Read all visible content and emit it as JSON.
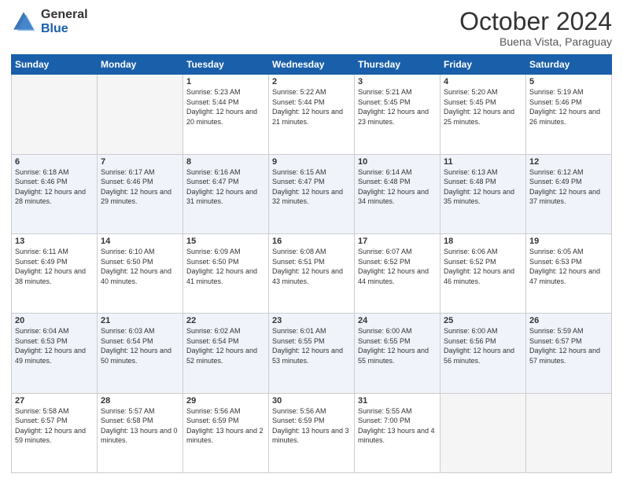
{
  "header": {
    "logo_general": "General",
    "logo_blue": "Blue",
    "month_title": "October 2024",
    "location": "Buena Vista, Paraguay"
  },
  "calendar": {
    "days_of_week": [
      "Sunday",
      "Monday",
      "Tuesday",
      "Wednesday",
      "Thursday",
      "Friday",
      "Saturday"
    ],
    "weeks": [
      [
        {
          "day": "",
          "empty": true
        },
        {
          "day": "",
          "empty": true
        },
        {
          "day": "1",
          "sunrise": "Sunrise: 5:23 AM",
          "sunset": "Sunset: 5:44 PM",
          "daylight": "Daylight: 12 hours and 20 minutes."
        },
        {
          "day": "2",
          "sunrise": "Sunrise: 5:22 AM",
          "sunset": "Sunset: 5:44 PM",
          "daylight": "Daylight: 12 hours and 21 minutes."
        },
        {
          "day": "3",
          "sunrise": "Sunrise: 5:21 AM",
          "sunset": "Sunset: 5:45 PM",
          "daylight": "Daylight: 12 hours and 23 minutes."
        },
        {
          "day": "4",
          "sunrise": "Sunrise: 5:20 AM",
          "sunset": "Sunset: 5:45 PM",
          "daylight": "Daylight: 12 hours and 25 minutes."
        },
        {
          "day": "5",
          "sunrise": "Sunrise: 5:19 AM",
          "sunset": "Sunset: 5:46 PM",
          "daylight": "Daylight: 12 hours and 26 minutes."
        }
      ],
      [
        {
          "day": "6",
          "sunrise": "Sunrise: 6:18 AM",
          "sunset": "Sunset: 6:46 PM",
          "daylight": "Daylight: 12 hours and 28 minutes."
        },
        {
          "day": "7",
          "sunrise": "Sunrise: 6:17 AM",
          "sunset": "Sunset: 6:46 PM",
          "daylight": "Daylight: 12 hours and 29 minutes."
        },
        {
          "day": "8",
          "sunrise": "Sunrise: 6:16 AM",
          "sunset": "Sunset: 6:47 PM",
          "daylight": "Daylight: 12 hours and 31 minutes."
        },
        {
          "day": "9",
          "sunrise": "Sunrise: 6:15 AM",
          "sunset": "Sunset: 6:47 PM",
          "daylight": "Daylight: 12 hours and 32 minutes."
        },
        {
          "day": "10",
          "sunrise": "Sunrise: 6:14 AM",
          "sunset": "Sunset: 6:48 PM",
          "daylight": "Daylight: 12 hours and 34 minutes."
        },
        {
          "day": "11",
          "sunrise": "Sunrise: 6:13 AM",
          "sunset": "Sunset: 6:48 PM",
          "daylight": "Daylight: 12 hours and 35 minutes."
        },
        {
          "day": "12",
          "sunrise": "Sunrise: 6:12 AM",
          "sunset": "Sunset: 6:49 PM",
          "daylight": "Daylight: 12 hours and 37 minutes."
        }
      ],
      [
        {
          "day": "13",
          "sunrise": "Sunrise: 6:11 AM",
          "sunset": "Sunset: 6:49 PM",
          "daylight": "Daylight: 12 hours and 38 minutes."
        },
        {
          "day": "14",
          "sunrise": "Sunrise: 6:10 AM",
          "sunset": "Sunset: 6:50 PM",
          "daylight": "Daylight: 12 hours and 40 minutes."
        },
        {
          "day": "15",
          "sunrise": "Sunrise: 6:09 AM",
          "sunset": "Sunset: 6:50 PM",
          "daylight": "Daylight: 12 hours and 41 minutes."
        },
        {
          "day": "16",
          "sunrise": "Sunrise: 6:08 AM",
          "sunset": "Sunset: 6:51 PM",
          "daylight": "Daylight: 12 hours and 43 minutes."
        },
        {
          "day": "17",
          "sunrise": "Sunrise: 6:07 AM",
          "sunset": "Sunset: 6:52 PM",
          "daylight": "Daylight: 12 hours and 44 minutes."
        },
        {
          "day": "18",
          "sunrise": "Sunrise: 6:06 AM",
          "sunset": "Sunset: 6:52 PM",
          "daylight": "Daylight: 12 hours and 46 minutes."
        },
        {
          "day": "19",
          "sunrise": "Sunrise: 6:05 AM",
          "sunset": "Sunset: 6:53 PM",
          "daylight": "Daylight: 12 hours and 47 minutes."
        }
      ],
      [
        {
          "day": "20",
          "sunrise": "Sunrise: 6:04 AM",
          "sunset": "Sunset: 6:53 PM",
          "daylight": "Daylight: 12 hours and 49 minutes."
        },
        {
          "day": "21",
          "sunrise": "Sunrise: 6:03 AM",
          "sunset": "Sunset: 6:54 PM",
          "daylight": "Daylight: 12 hours and 50 minutes."
        },
        {
          "day": "22",
          "sunrise": "Sunrise: 6:02 AM",
          "sunset": "Sunset: 6:54 PM",
          "daylight": "Daylight: 12 hours and 52 minutes."
        },
        {
          "day": "23",
          "sunrise": "Sunrise: 6:01 AM",
          "sunset": "Sunset: 6:55 PM",
          "daylight": "Daylight: 12 hours and 53 minutes."
        },
        {
          "day": "24",
          "sunrise": "Sunrise: 6:00 AM",
          "sunset": "Sunset: 6:55 PM",
          "daylight": "Daylight: 12 hours and 55 minutes."
        },
        {
          "day": "25",
          "sunrise": "Sunrise: 6:00 AM",
          "sunset": "Sunset: 6:56 PM",
          "daylight": "Daylight: 12 hours and 56 minutes."
        },
        {
          "day": "26",
          "sunrise": "Sunrise: 5:59 AM",
          "sunset": "Sunset: 6:57 PM",
          "daylight": "Daylight: 12 hours and 57 minutes."
        }
      ],
      [
        {
          "day": "27",
          "sunrise": "Sunrise: 5:58 AM",
          "sunset": "Sunset: 6:57 PM",
          "daylight": "Daylight: 12 hours and 59 minutes."
        },
        {
          "day": "28",
          "sunrise": "Sunrise: 5:57 AM",
          "sunset": "Sunset: 6:58 PM",
          "daylight": "Daylight: 13 hours and 0 minutes."
        },
        {
          "day": "29",
          "sunrise": "Sunrise: 5:56 AM",
          "sunset": "Sunset: 6:59 PM",
          "daylight": "Daylight: 13 hours and 2 minutes."
        },
        {
          "day": "30",
          "sunrise": "Sunrise: 5:56 AM",
          "sunset": "Sunset: 6:59 PM",
          "daylight": "Daylight: 13 hours and 3 minutes."
        },
        {
          "day": "31",
          "sunrise": "Sunrise: 5:55 AM",
          "sunset": "Sunset: 7:00 PM",
          "daylight": "Daylight: 13 hours and 4 minutes."
        },
        {
          "day": "",
          "empty": true
        },
        {
          "day": "",
          "empty": true
        }
      ]
    ]
  }
}
